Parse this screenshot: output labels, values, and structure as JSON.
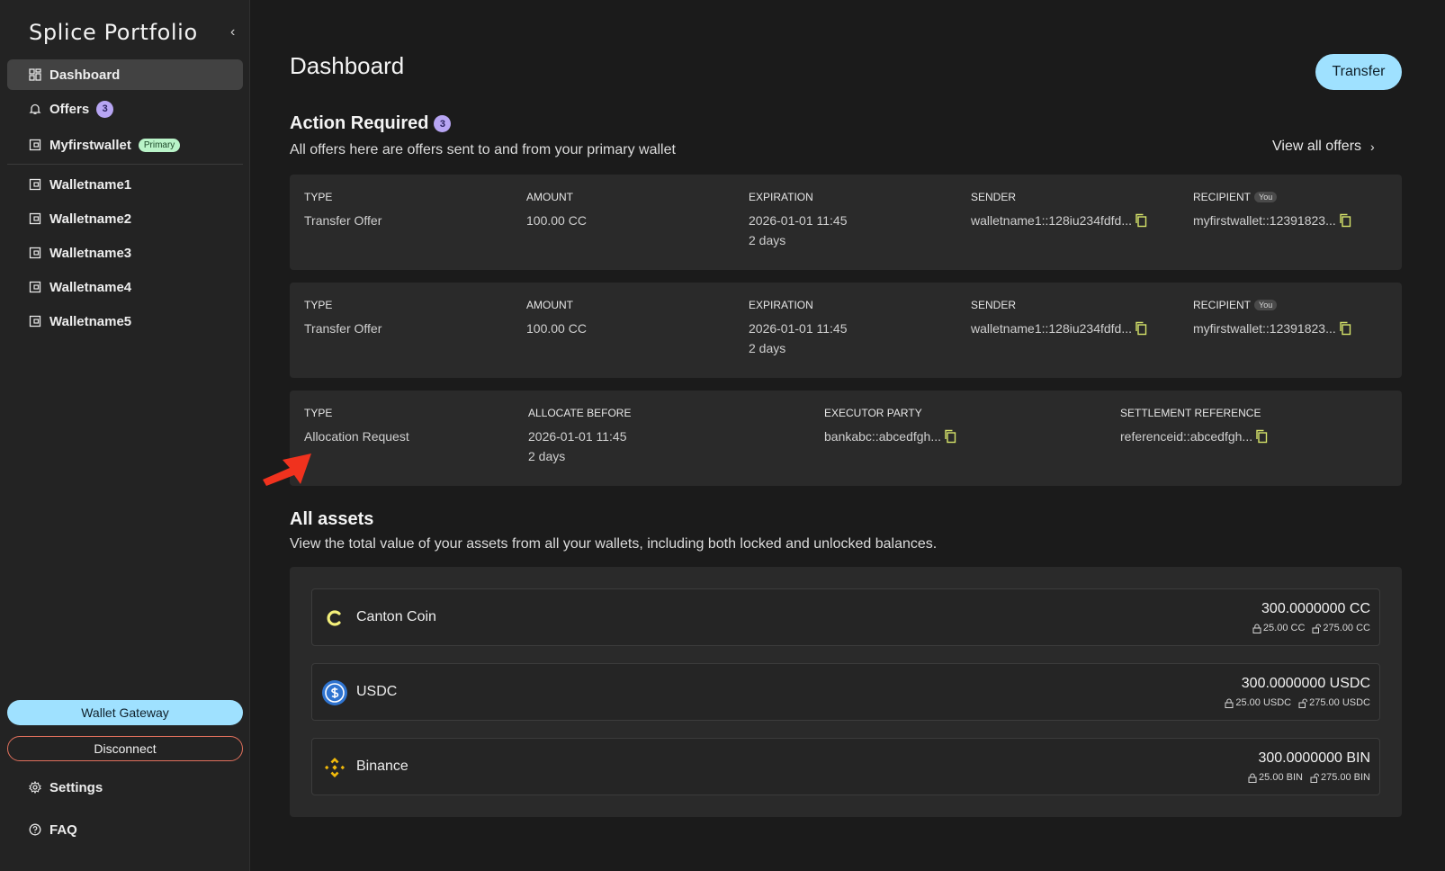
{
  "brand": "Splice Portfolio",
  "sidebar": {
    "items": [
      {
        "label": "Dashboard",
        "icon": "grid-icon",
        "active": true
      },
      {
        "label": "Offers",
        "icon": "bell-icon",
        "badge": "3"
      },
      {
        "label": "Myfirstwallet",
        "icon": "wallet-icon",
        "tag": "Primary"
      },
      {
        "label": "Walletname1",
        "icon": "wallet-icon"
      },
      {
        "label": "Walletname2",
        "icon": "wallet-icon"
      },
      {
        "label": "Walletname3",
        "icon": "wallet-icon"
      },
      {
        "label": "Walletname4",
        "icon": "wallet-icon"
      },
      {
        "label": "Walletname5",
        "icon": "wallet-icon"
      }
    ],
    "gateway_label": "Wallet Gateway",
    "disconnect_label": "Disconnect",
    "settings_label": "Settings",
    "faq_label": "FAQ"
  },
  "header": {
    "title": "Dashboard",
    "transfer_label": "Transfer"
  },
  "action_required": {
    "title": "Action Required",
    "count": "3",
    "subtitle": "All offers here are offers sent to and from your primary wallet",
    "view_all": "View all offers",
    "offers": [
      {
        "type_label": "TYPE",
        "type": "Transfer Offer",
        "amount_label": "AMOUNT",
        "amount": "100.00 CC",
        "expiration_label": "EXPIRATION",
        "expiration": "2026-01-01 11:45",
        "expiration_rel": "2 days",
        "sender_label": "SENDER",
        "sender": "walletname1::128iu234fdfd...",
        "recipient_label": "RECIPIENT",
        "you_tag": "You",
        "recipient": "myfirstwallet::12391823..."
      },
      {
        "type_label": "TYPE",
        "type": "Transfer Offer",
        "amount_label": "AMOUNT",
        "amount": "100.00 CC",
        "expiration_label": "EXPIRATION",
        "expiration": "2026-01-01 11:45",
        "expiration_rel": "2 days",
        "sender_label": "SENDER",
        "sender": "walletname1::128iu234fdfd...",
        "recipient_label": "RECIPIENT",
        "you_tag": "You",
        "recipient": "myfirstwallet::12391823..."
      }
    ],
    "allocation": {
      "type_label": "TYPE",
      "type": "Allocation Request",
      "allocate_label": "ALLOCATE BEFORE",
      "allocate": "2026-01-01 11:45",
      "allocate_rel": "2 days",
      "executor_label": "EXECUTOR PARTY",
      "executor": "bankabc::abcedfgh...",
      "settlement_label": "SETTLEMENT REFERENCE",
      "settlement": "referenceid::abcedfgh..."
    }
  },
  "assets": {
    "title": "All assets",
    "subtitle": "View the total value of your assets from all your wallets, including both locked and unlocked balances.",
    "items": [
      {
        "name": "Canton Coin",
        "icon": "canton-coin-icon",
        "total": "300.0000000 CC",
        "locked": "25.00 CC",
        "unlocked": "275.00 CC"
      },
      {
        "name": "USDC",
        "icon": "usdc-icon",
        "total": "300.0000000 USDC",
        "locked": "25.00 USDC",
        "unlocked": "275.00 USDC"
      },
      {
        "name": "Binance",
        "icon": "binance-icon",
        "total": "300.0000000 BIN",
        "locked": "25.00 BIN",
        "unlocked": "275.00 BIN"
      }
    ]
  },
  "colors": {
    "accent": "#9fe1ff",
    "badge": "#b7a5f3",
    "primary_tag": "#b9f3c8",
    "copy_icon": "#d6e36a",
    "disconnect_border": "#e0705c",
    "annotation_arrow": "#f0321e"
  }
}
